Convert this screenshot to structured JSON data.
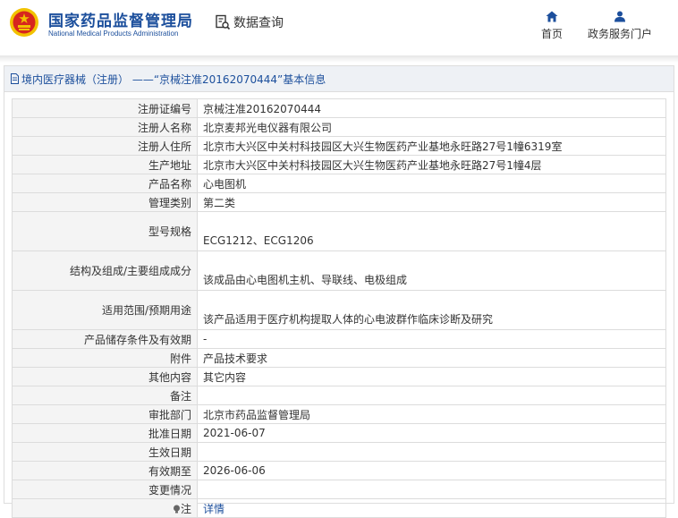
{
  "header": {
    "title_cn": "国家药品监督管理局",
    "title_en": "National Medical Products Administration",
    "data_query": "数据查询",
    "nav_home": "首页",
    "nav_portal": "政务服务门户"
  },
  "panel": {
    "title": "境内医疗器械（注册） ——“京械注准20162070444”基本信息"
  },
  "rows": [
    {
      "label": "注册证编号",
      "value": "京械注准20162070444"
    },
    {
      "label": "注册人名称",
      "value": "北京麦邦光电仪器有限公司"
    },
    {
      "label": "注册人住所",
      "value": "北京市大兴区中关村科技园区大兴生物医药产业基地永旺路27号1幢6319室"
    },
    {
      "label": "生产地址",
      "value": "北京市大兴区中关村科技园区大兴生物医药产业基地永旺路27号1幢4层"
    },
    {
      "label": "产品名称",
      "value": "心电图机"
    },
    {
      "label": "管理类别",
      "value": "第二类"
    },
    {
      "label": "型号规格",
      "value": "ECG1212、ECG1206"
    },
    {
      "label": "结构及组成/主要组成成分",
      "value": "该成品由心电图机主机、导联线、电极组成"
    },
    {
      "label": "适用范围/预期用途",
      "value": "该产品适用于医疗机构提取人体的心电波群作临床诊断及研究"
    },
    {
      "label": "产品储存条件及有效期",
      "value": "-"
    },
    {
      "label": "附件",
      "value": "产品技术要求"
    },
    {
      "label": "其他内容",
      "value": "其它内容"
    },
    {
      "label": "备注",
      "value": ""
    },
    {
      "label": "审批部门",
      "value": "北京市药品监督管理局"
    },
    {
      "label": "批准日期",
      "value": "2021-06-07"
    },
    {
      "label": "生效日期",
      "value": ""
    },
    {
      "label": "有效期至",
      "value": "2026-06-06"
    },
    {
      "label": "变更情况",
      "value": ""
    },
    {
      "label": "注",
      "value": "详情"
    }
  ],
  "colors": {
    "brand_blue": "#1c4f9c",
    "logo_red": "#d7261e",
    "logo_gold": "#f2c200"
  }
}
